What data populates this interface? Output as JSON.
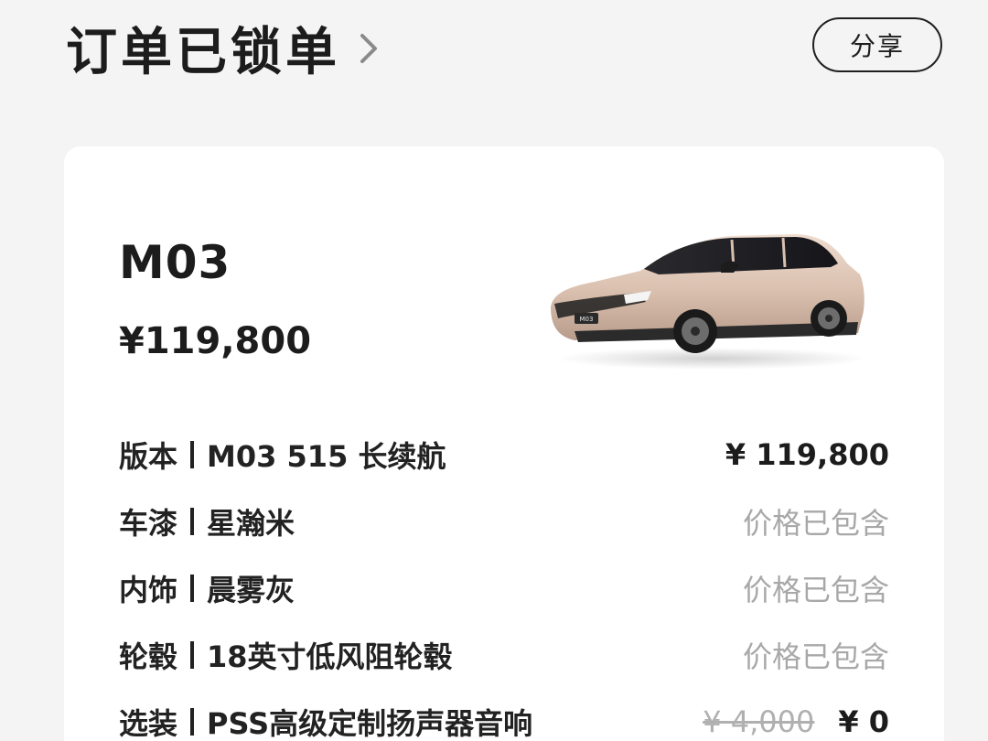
{
  "header": {
    "title": "订单已锁单",
    "share_label": "分享"
  },
  "card": {
    "model": "M03",
    "price": "¥119,800",
    "car_badge": "M03",
    "specs": [
      {
        "label": "版本",
        "value": "M03 515 长续航",
        "price": "¥ 119,800",
        "price_style": "bold"
      },
      {
        "label": "车漆",
        "value": "星瀚米",
        "price": "价格已包含",
        "price_style": "muted"
      },
      {
        "label": "内饰",
        "value": "晨雾灰",
        "price": "价格已包含",
        "price_style": "muted"
      },
      {
        "label": "轮毂",
        "value": "18英寸低风阻轮毂",
        "price": "价格已包含",
        "price_style": "muted"
      },
      {
        "label": "选装",
        "value": "PSS高级定制扬声器音响",
        "original_price": "¥ 4,000",
        "price": "¥ 0",
        "price_style": "bold"
      }
    ]
  },
  "colors": {
    "background": "#f4f4f4",
    "card": "#ffffff",
    "text": "#1c1c1c",
    "muted": "#a8a8a8",
    "car_paint": "#d9bfae"
  }
}
